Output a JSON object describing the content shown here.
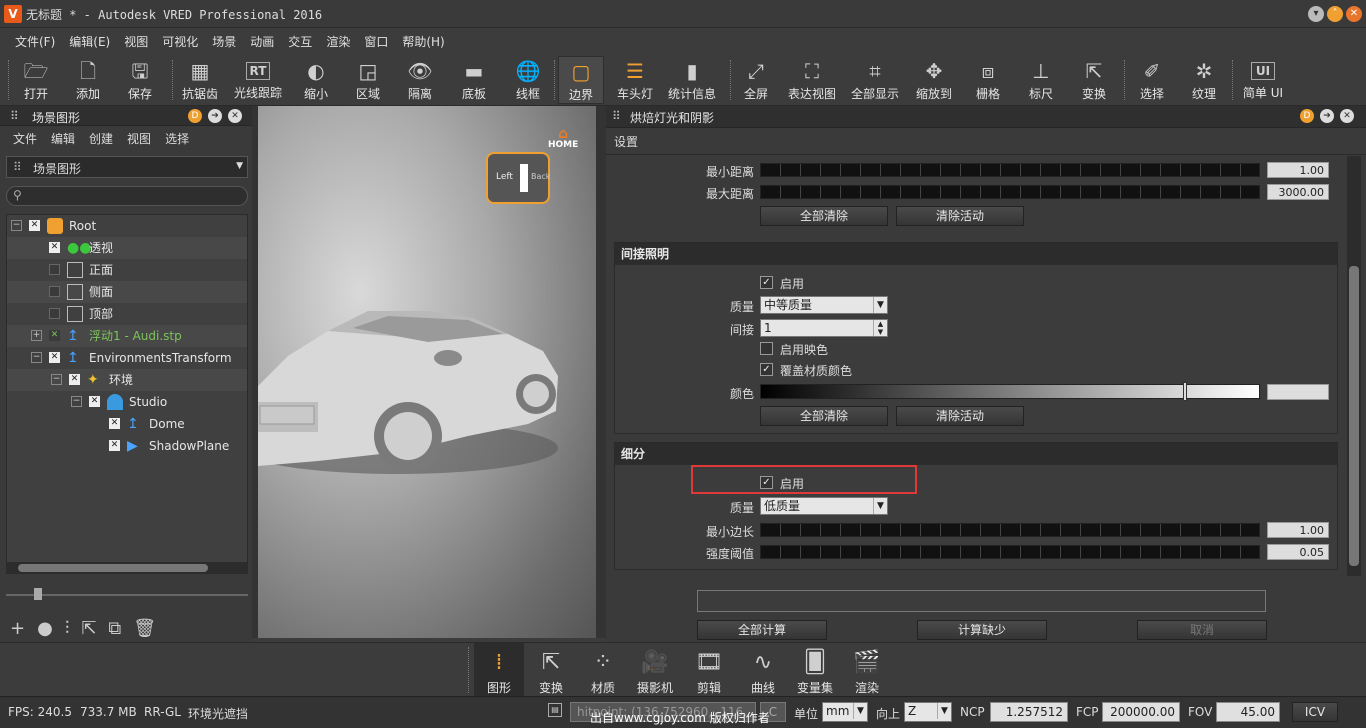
{
  "window": {
    "title": "无标题 * - Autodesk VRED Professional 2016",
    "logo": "V"
  },
  "menu": [
    "文件(F)",
    "编辑(E)",
    "视图",
    "可视化",
    "场景",
    "动画",
    "交互",
    "渲染",
    "窗口",
    "帮助(H)"
  ],
  "toolbar": [
    {
      "label": "打开",
      "icon": "folder-open-icon"
    },
    {
      "label": "添加",
      "icon": "add-file-icon"
    },
    {
      "label": "保存",
      "icon": "save-icon"
    },
    {
      "label": "抗锯齿",
      "icon": "antialias-icon"
    },
    {
      "label": "光线跟踪",
      "icon": "raytrace-icon",
      "glyph": "RT"
    },
    {
      "label": "缩小",
      "icon": "shading-icon"
    },
    {
      "label": "区域",
      "icon": "region-icon"
    },
    {
      "label": "隔离",
      "icon": "isolate-icon"
    },
    {
      "label": "底板",
      "icon": "backplate-icon"
    },
    {
      "label": "线框",
      "icon": "wireframe-icon"
    },
    {
      "label": "边界",
      "icon": "bounds-icon"
    },
    {
      "label": "车头灯",
      "icon": "headlight-icon"
    },
    {
      "label": "统计信息",
      "icon": "statistics-icon"
    },
    {
      "label": "全屏",
      "icon": "fullscreen-icon"
    },
    {
      "label": "表达视图",
      "icon": "presentation-icon"
    },
    {
      "label": "全部显示",
      "icon": "show-all-icon"
    },
    {
      "label": "缩放到",
      "icon": "zoom-to-icon"
    },
    {
      "label": "栅格",
      "icon": "grid-icon"
    },
    {
      "label": "标尺",
      "icon": "ruler-icon"
    },
    {
      "label": "变换",
      "icon": "transform-icon"
    },
    {
      "label": "选择",
      "icon": "select-icon"
    },
    {
      "label": "纹理",
      "icon": "texture-icon"
    },
    {
      "label": "简单",
      "icon": "simple-ui-icon",
      "glyph": "UI"
    },
    {
      "label": "UI",
      "icon": ""
    }
  ],
  "scenegraph": {
    "title": "场景图形",
    "menu": [
      "文件",
      "编辑",
      "创建",
      "视图",
      "选择"
    ],
    "combo": "场景图形",
    "search_placeholder": "",
    "nodes": [
      {
        "label": "Root",
        "color": "#e6e6e6"
      },
      {
        "label": "透视",
        "color": "#e6e6e6"
      },
      {
        "label": "正面",
        "color": "#e6e6e6"
      },
      {
        "label": "侧面",
        "color": "#e6e6e6"
      },
      {
        "label": "顶部",
        "color": "#e6e6e6"
      },
      {
        "label": "浮动1 - Audi.stp",
        "color": "#7dc35b"
      },
      {
        "label": "EnvironmentsTransform",
        "color": "#e6e6e6"
      },
      {
        "label": "环境",
        "color": "#e6e6e6"
      },
      {
        "label": "Studio",
        "color": "#e6e6e6"
      },
      {
        "label": "Dome",
        "color": "#e6e6e6"
      },
      {
        "label": "ShadowPlane",
        "color": "#e6e6e6"
      }
    ]
  },
  "viewcube": {
    "home": "HOME",
    "left": "Left",
    "back": "Back"
  },
  "bake": {
    "title": "烘焙灯光和阴影",
    "tab": "设置",
    "min_dist_label": "最小距离",
    "min_dist": "1.00",
    "max_dist_label": "最大距离",
    "max_dist": "3000.00",
    "clear_all": "全部清除",
    "clear_active": "清除活动",
    "indirect": {
      "title": "间接照明",
      "enable": "启用",
      "quality_label": "质量",
      "quality": "中等质量",
      "bounce_label": "间接",
      "bounce": "1",
      "enable_tint": "启用映色",
      "override_mat": "覆盖材质颜色",
      "color_label": "颜色"
    },
    "subdiv": {
      "title": "细分",
      "enable": "启用",
      "quality_label": "质量",
      "quality": "低质量",
      "min_edge_label": "最小边长",
      "min_edge": "1.00",
      "intensity_label": "强度阈值",
      "intensity": "0.05"
    },
    "compute_all": "全部计算",
    "compute_missing": "计算缺少",
    "cancel": "取消"
  },
  "bottom": [
    {
      "label": "图形",
      "icon": "scenegraph-icon"
    },
    {
      "label": "变换",
      "icon": "transform-icon"
    },
    {
      "label": "材质",
      "icon": "materials-icon"
    },
    {
      "label": "摄影机",
      "icon": "camera-icon"
    },
    {
      "label": "剪辑",
      "icon": "clips-icon"
    },
    {
      "label": "曲线",
      "icon": "curves-icon"
    },
    {
      "label": "变量集",
      "icon": "variantsets-icon"
    },
    {
      "label": "渲染",
      "icon": "render-icon"
    }
  ],
  "status": {
    "fps": "FPS: 240.5",
    "mem": "733.7 MB",
    "renderer": "RR-GL",
    "mode": "环境光遮挡",
    "hitpoint": "hitpoint: (136.752960, -116.",
    "c": "C",
    "watermark": "出自www.cgjoy.com 版权归作者",
    "unit_label": "单位",
    "unit": "mm",
    "up_label": "向上",
    "up": "Z",
    "ncp_label": "NCP",
    "ncp": "1.257512",
    "fcp_label": "FCP",
    "fcp": "200000.00",
    "fov_label": "FOV",
    "fov": "45.00",
    "icv": "ICV"
  }
}
